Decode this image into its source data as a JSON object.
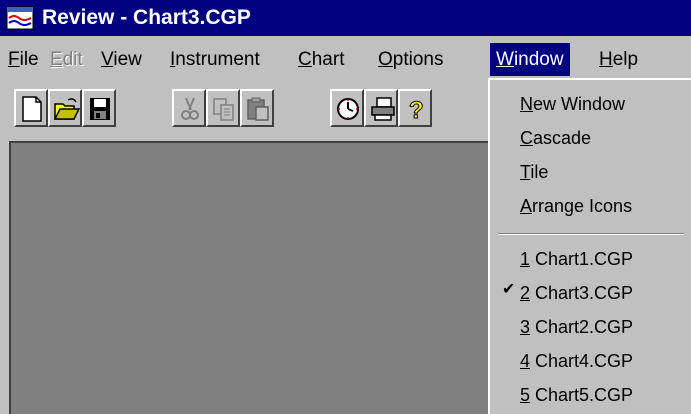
{
  "window": {
    "title": "Review - Chart3.CGP"
  },
  "menu": {
    "items": [
      {
        "label": "File",
        "mnemonic": "F",
        "rest": "ile"
      },
      {
        "label": "Edit",
        "mnemonic": "E",
        "rest": "dit",
        "disabled": true
      },
      {
        "label": "View",
        "mnemonic": "V",
        "rest": "iew"
      },
      {
        "label": "Instrument",
        "mnemonic": "I",
        "rest": "nstrument"
      },
      {
        "label": "Chart",
        "mnemonic": "C",
        "rest": "hart"
      },
      {
        "label": "Options",
        "mnemonic": "O",
        "rest": "ptions"
      },
      {
        "label": "Window",
        "mnemonic": "W",
        "rest": "indow",
        "active": true
      },
      {
        "label": "Help",
        "mnemonic": "H",
        "rest": "elp"
      }
    ]
  },
  "toolbar": {
    "buttons": [
      {
        "name": "new-file-icon",
        "enabled": true
      },
      {
        "name": "open-folder-icon",
        "enabled": true
      },
      {
        "name": "save-disk-icon",
        "enabled": true
      },
      {
        "name": "cut-icon",
        "enabled": false
      },
      {
        "name": "copy-icon",
        "enabled": false
      },
      {
        "name": "paste-icon",
        "enabled": false
      },
      {
        "name": "clock-icon",
        "enabled": true
      },
      {
        "name": "print-icon",
        "enabled": true
      },
      {
        "name": "help-icon",
        "enabled": true
      }
    ]
  },
  "window_menu": {
    "commands": [
      {
        "label": "New Window",
        "mnemonic": "N",
        "rest": "ew Window"
      },
      {
        "label": "Cascade",
        "mnemonic": "C",
        "rest": "ascade"
      },
      {
        "label": "Tile",
        "mnemonic": "T",
        "rest": "ile"
      },
      {
        "label": "Arrange Icons",
        "mnemonic": "A",
        "rest": "rrange Icons"
      }
    ],
    "open_windows": [
      {
        "number": "1",
        "name": " Chart1.CGP",
        "checked": false
      },
      {
        "number": "2",
        "name": " Chart3.CGP",
        "checked": true
      },
      {
        "number": "3",
        "name": " Chart2.CGP",
        "checked": false
      },
      {
        "number": "4",
        "name": " Chart4.CGP",
        "checked": false
      },
      {
        "number": "5",
        "name": " Chart5.CGP",
        "checked": false
      }
    ],
    "check_glyph": "✔"
  },
  "colors": {
    "title_bg": "#000080",
    "face": "#c0c0c0",
    "workspace": "#808080"
  }
}
